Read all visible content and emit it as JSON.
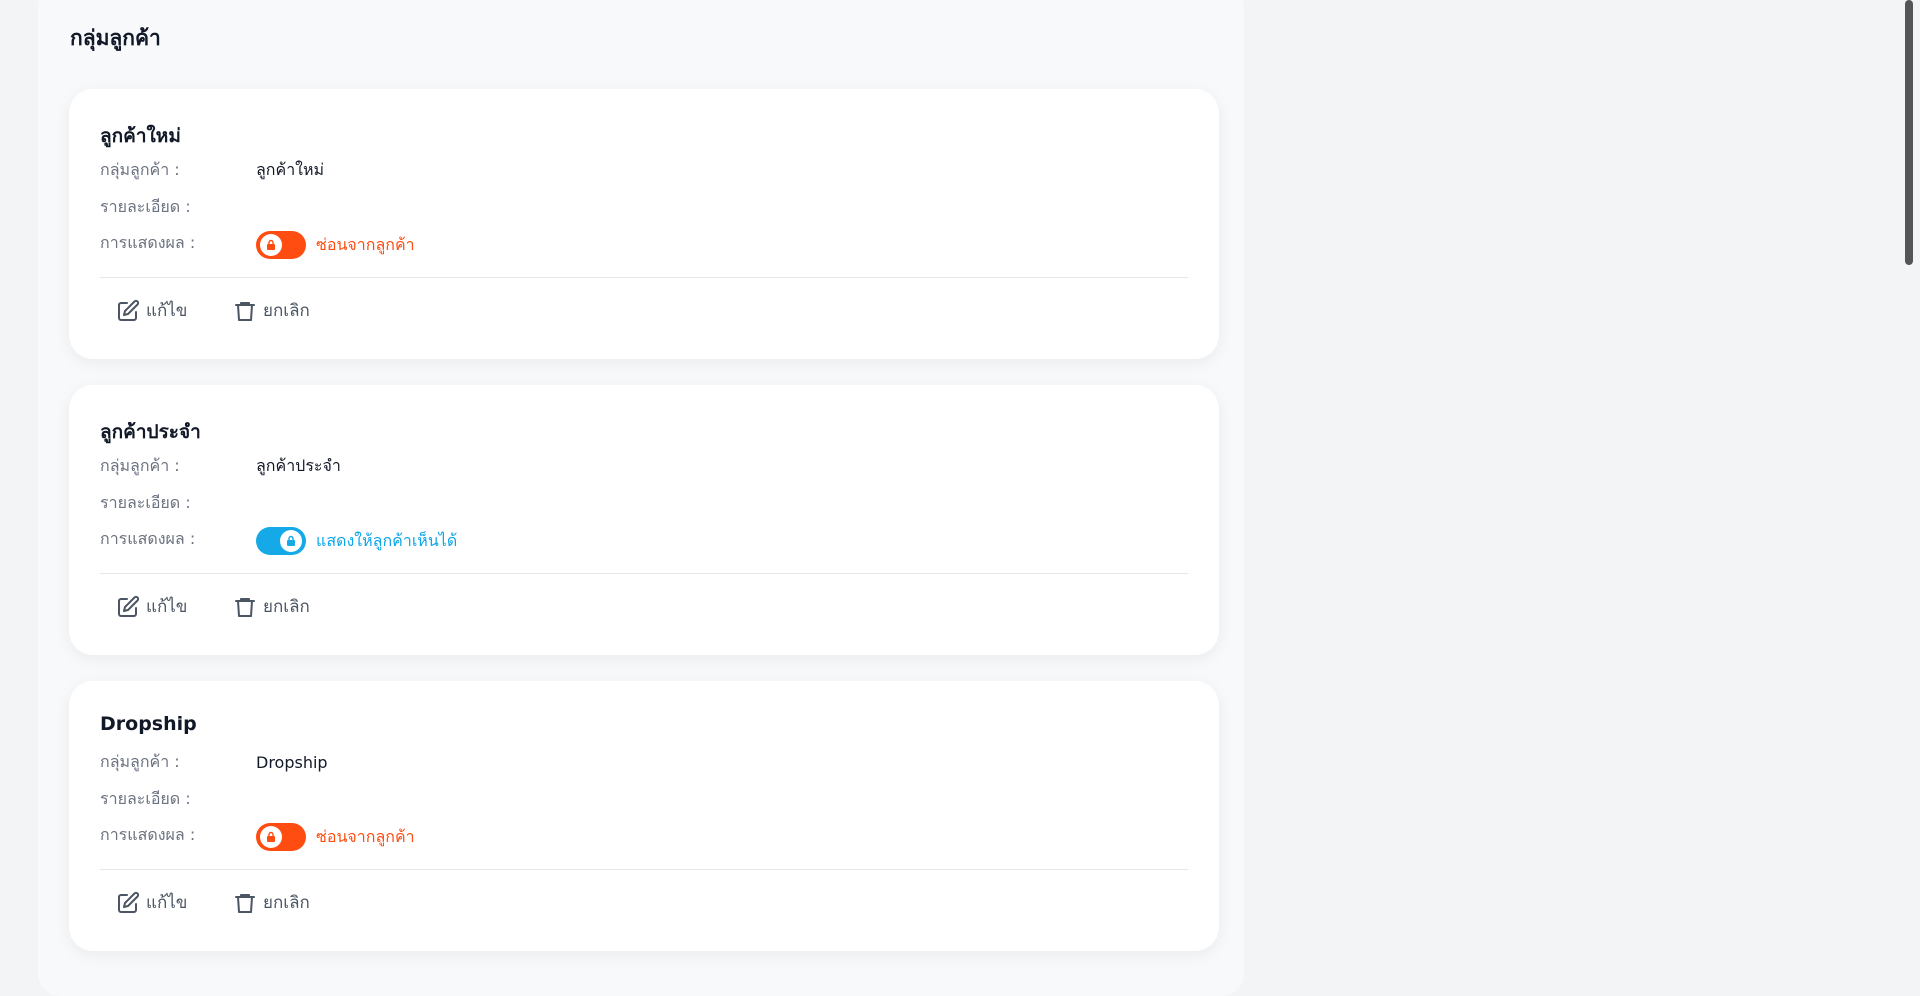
{
  "page": {
    "section_title": "กลุ่มลูกค้า"
  },
  "labels": {
    "group": "กลุ่มลูกค้า :",
    "detail": "รายละเอียด :",
    "display": "การแสดงผล :"
  },
  "actions": {
    "edit": "แก้ไข",
    "delete": "ยกเลิก"
  },
  "groups": [
    {
      "title": "ลูกค้าใหม่",
      "group_value": "ลูกค้าใหม่",
      "detail_value": "",
      "visible": false,
      "status_text": "ซ่อนจากลูกค้า"
    },
    {
      "title": "ลูกค้าประจำ",
      "group_value": "ลูกค้าประจำ",
      "detail_value": "",
      "visible": true,
      "status_text": "แสดงให้ลูกค้าเห็นได้"
    },
    {
      "title": "Dropship",
      "group_value": "Dropship",
      "detail_value": "",
      "visible": false,
      "status_text": "ซ่อนจากลูกค้า"
    }
  ],
  "colors": {
    "hidden": "#ff4d12",
    "visible": "#16a9e8"
  },
  "icons": {
    "edit": "edit-icon",
    "delete": "trash-icon",
    "toggle_knob": "lock-icon"
  }
}
